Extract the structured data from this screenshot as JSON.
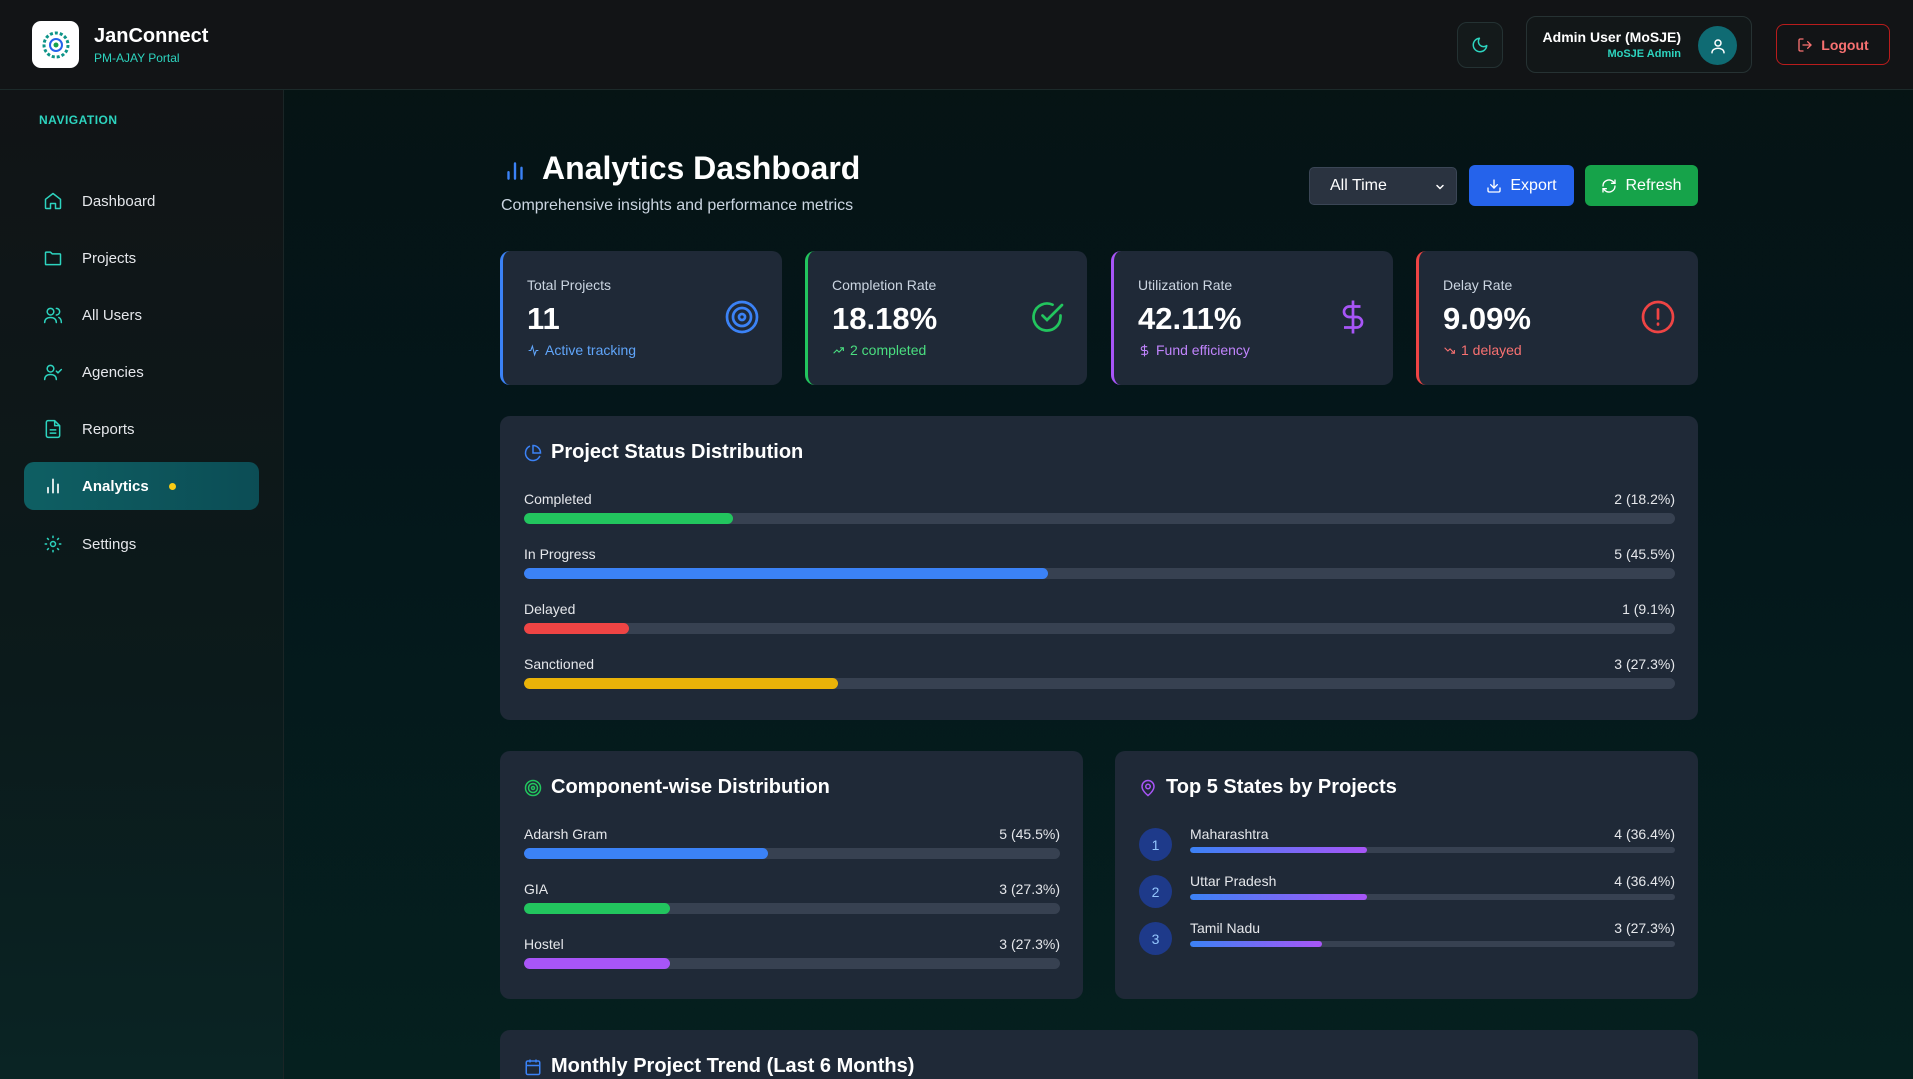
{
  "header": {
    "brand_title": "JanConnect",
    "brand_sub": "PM-AJAY Portal",
    "user_name": "Admin User (MoSJE)",
    "user_role": "MoSJE Admin",
    "logout_label": "Logout"
  },
  "sidebar": {
    "heading": "NAVIGATION",
    "items": [
      {
        "label": "Dashboard",
        "icon": "home-icon"
      },
      {
        "label": "Projects",
        "icon": "folder-icon"
      },
      {
        "label": "All Users",
        "icon": "users-icon"
      },
      {
        "label": "Agencies",
        "icon": "user-check-icon"
      },
      {
        "label": "Reports",
        "icon": "file-text-icon"
      },
      {
        "label": "Analytics",
        "icon": "bar-chart-icon",
        "active": true
      },
      {
        "label": "Settings",
        "icon": "gear-icon"
      }
    ]
  },
  "main": {
    "title": "Analytics Dashboard",
    "subtitle": "Comprehensive insights and performance metrics",
    "time_filter": "All Time",
    "export_label": "Export",
    "refresh_label": "Refresh"
  },
  "stats": [
    {
      "label": "Total Projects",
      "value": "11",
      "foot": "Active tracking",
      "color": "#3b82f6"
    },
    {
      "label": "Completion Rate",
      "value": "18.18%",
      "foot": "2 completed",
      "color": "#22c55e"
    },
    {
      "label": "Utilization Rate",
      "value": "42.11%",
      "foot": "Fund efficiency",
      "color": "#a855f7"
    },
    {
      "label": "Delay Rate",
      "value": "9.09%",
      "foot": "1 delayed",
      "color": "#ef4444"
    }
  ],
  "status_panel": {
    "title": "Project Status Distribution",
    "rows": [
      {
        "label": "Completed",
        "value": "2 (18.2%)",
        "pct": 18.2,
        "color": "#22c55e"
      },
      {
        "label": "In Progress",
        "value": "5 (45.5%)",
        "pct": 45.5,
        "color": "#3b82f6"
      },
      {
        "label": "Delayed",
        "value": "1 (9.1%)",
        "pct": 9.1,
        "color": "#ef4444"
      },
      {
        "label": "Sanctioned",
        "value": "3 (27.3%)",
        "pct": 27.3,
        "color": "#eab308"
      }
    ]
  },
  "component_panel": {
    "title": "Component-wise Distribution",
    "rows": [
      {
        "label": "Adarsh Gram",
        "value": "5 (45.5%)",
        "pct": 45.5,
        "color": "#3b82f6"
      },
      {
        "label": "GIA",
        "value": "3 (27.3%)",
        "pct": 27.3,
        "color": "#22c55e"
      },
      {
        "label": "Hostel",
        "value": "3 (27.3%)",
        "pct": 27.3,
        "color": "#a855f7"
      }
    ]
  },
  "states_panel": {
    "title": "Top 5 States by Projects",
    "rows": [
      {
        "rank": "1",
        "label": "Maharashtra",
        "value": "4 (36.4%)",
        "pct": 36.4
      },
      {
        "rank": "2",
        "label": "Uttar Pradesh",
        "value": "4 (36.4%)",
        "pct": 36.4
      },
      {
        "rank": "3",
        "label": "Tamil Nadu",
        "value": "3 (27.3%)",
        "pct": 27.3
      }
    ]
  },
  "trend_panel": {
    "title": "Monthly Project Trend (Last 6 Months)"
  }
}
